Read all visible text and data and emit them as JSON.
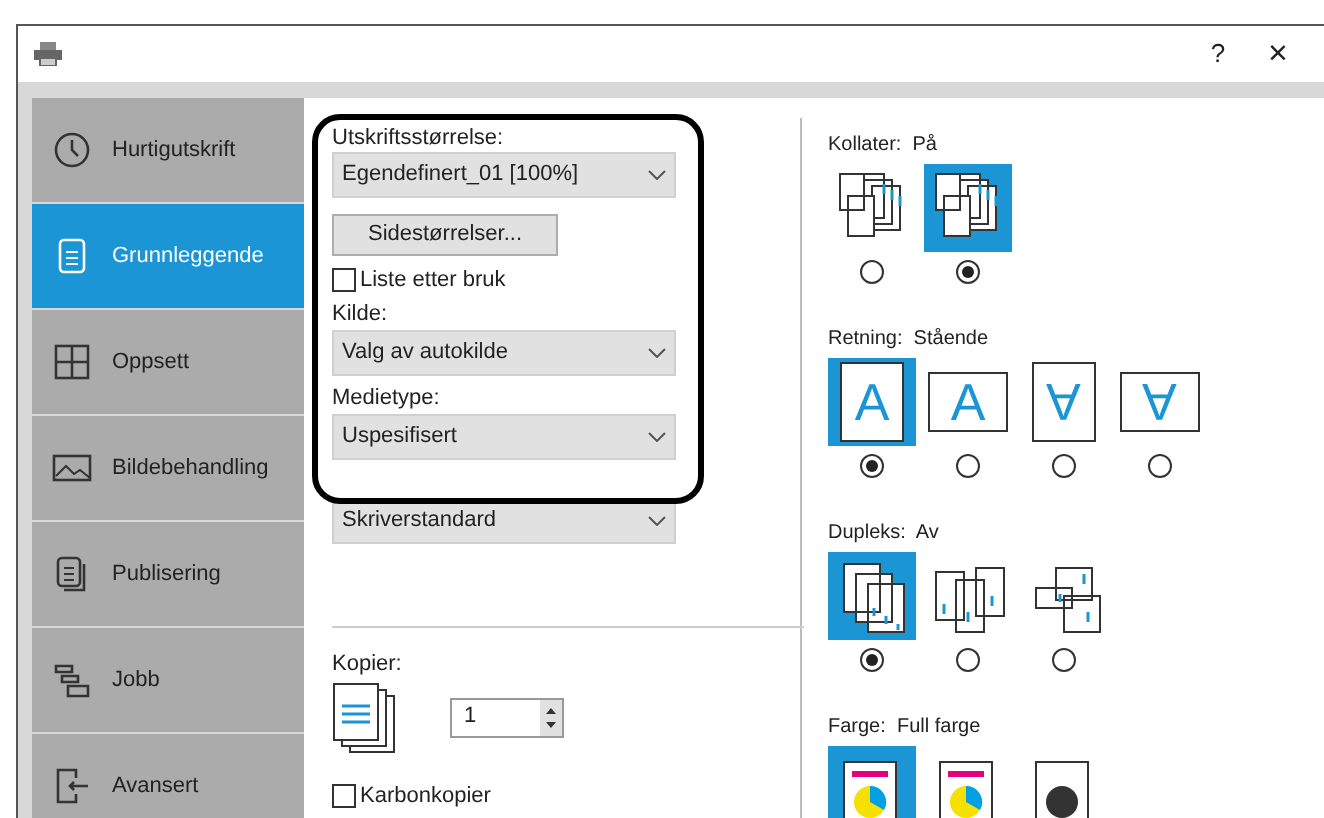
{
  "window": {
    "help": "?",
    "close": "×"
  },
  "sidebar": {
    "items": [
      {
        "label": "Hurtigutskrift",
        "selected": false
      },
      {
        "label": "Grunnleggende",
        "selected": true
      },
      {
        "label": "Oppsett",
        "selected": false
      },
      {
        "label": "Bildebehandling",
        "selected": false
      },
      {
        "label": "Publisering",
        "selected": false
      },
      {
        "label": "Jobb",
        "selected": false
      },
      {
        "label": "Avansert",
        "selected": false
      }
    ]
  },
  "basic": {
    "print_size": {
      "label": "Utskriftsstørrelse:",
      "value": "Egendefinert_01 [100%]"
    },
    "page_sizes_button": "Sidestørrelser...",
    "list_after_use": {
      "label": "Liste etter bruk",
      "checked": false
    },
    "source": {
      "label": "Kilde:",
      "value": "Valg av autokilde"
    },
    "media_type": {
      "label": "Medietype:",
      "value": "Uspesifisert"
    },
    "dropdown_4": {
      "value": "Skriverstandard"
    },
    "copies": {
      "label": "Kopier:",
      "value": "1"
    },
    "carbon_copies": {
      "label": "Karbonkopier",
      "checked": false
    }
  },
  "groups": [
    {
      "kind": "collate",
      "label": "Kollater:",
      "value": "På",
      "options": [
        {
          "selected": false
        },
        {
          "selected": true
        }
      ]
    },
    {
      "kind": "orientation",
      "label": "Retning:",
      "value": "Stående",
      "options": [
        {
          "selected": true,
          "glyph": "A",
          "rotated": false
        },
        {
          "selected": false,
          "glyph": "A",
          "rotated": false
        },
        {
          "selected": false,
          "glyph": "A",
          "rotated": true
        },
        {
          "selected": false,
          "glyph": "A",
          "rotated": true
        }
      ]
    },
    {
      "kind": "duplex",
      "label": "Dupleks:",
      "value": "Av",
      "options": [
        {
          "selected": true
        },
        {
          "selected": false
        },
        {
          "selected": false
        }
      ]
    },
    {
      "kind": "color",
      "label": "Farge:",
      "value": "Full farge",
      "options": [
        {
          "selected": true
        },
        {
          "selected": false
        },
        {
          "selected": false
        }
      ]
    }
  ]
}
